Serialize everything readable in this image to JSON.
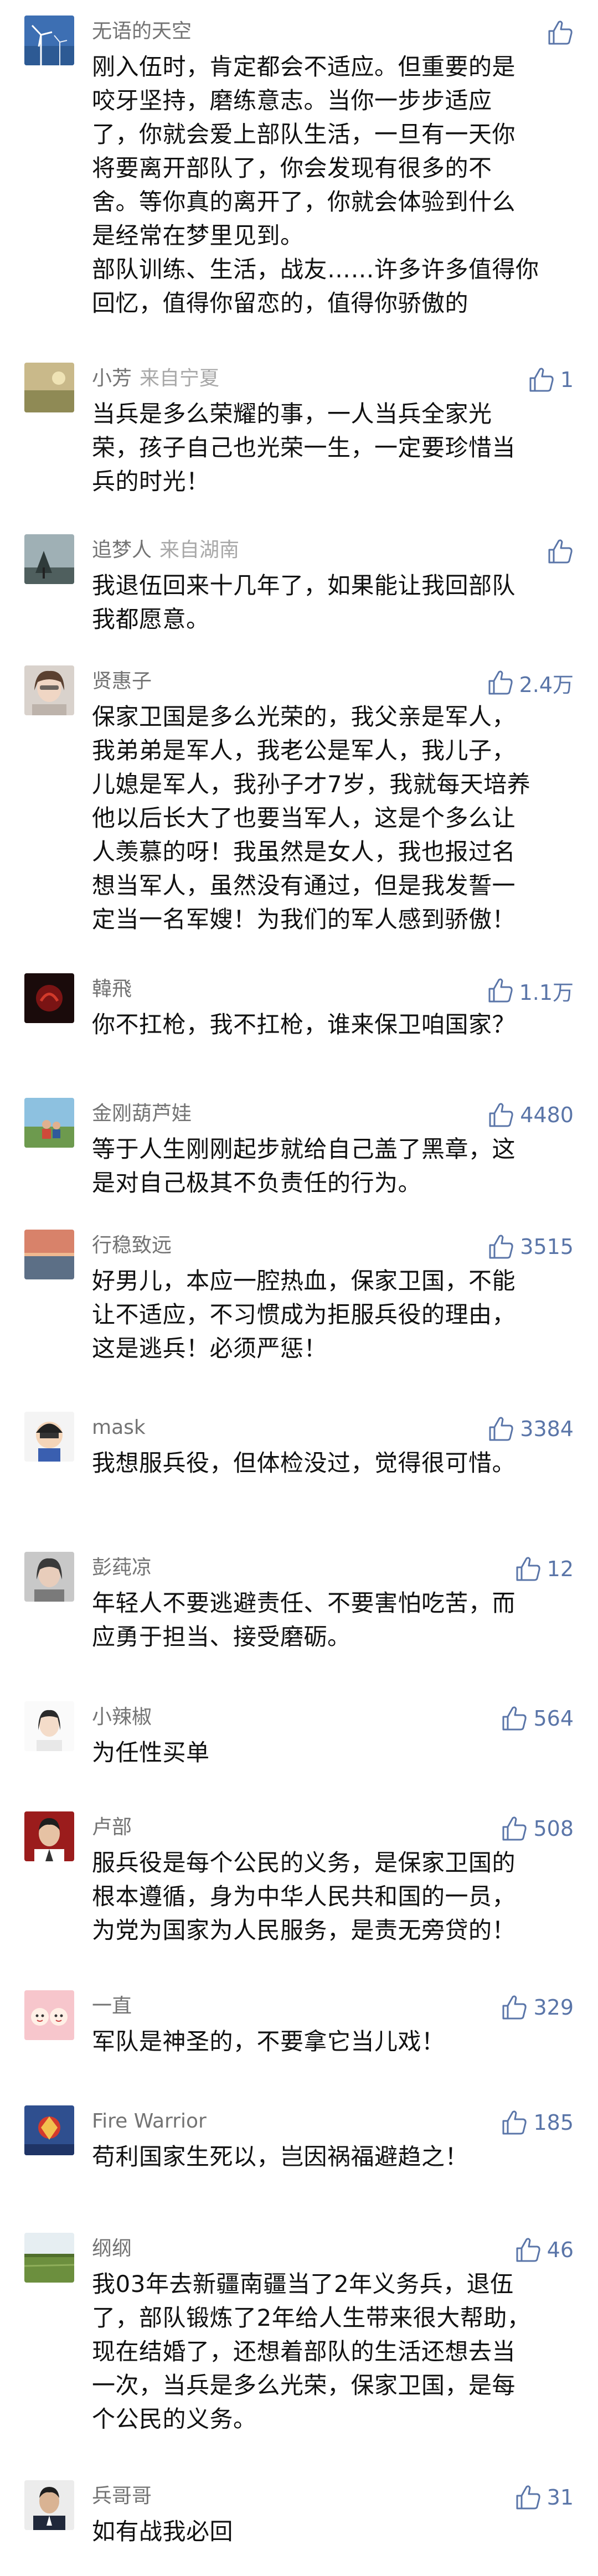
{
  "comments": [
    {
      "name": "无语的天空",
      "from": "",
      "likes": "",
      "avatar": "wind-turbine-avatar",
      "lines": [
        "刚入伍时，肯定都会不适应。但重要的是",
        "咬牙坚持，磨练意志。当你一步步适应",
        "了，你就会爱上部队生活，一旦有一天你",
        "将要离开部队了，你会发现有很多的不",
        "舍。等你真的离开了，你就会体验到什么",
        "是经常在梦里见到。",
        "部队训练、生活，战友……许多许多值得你",
        "回忆，值得你留恋的，值得你骄傲的"
      ]
    },
    {
      "name": "小芳",
      "from": "来自宁夏",
      "likes": "1",
      "avatar": "landscape-avatar",
      "lines": [
        "当兵是多么荣耀的事，一人当兵全家光",
        "荣，孩子自己也光荣一生，一定要珍惜当",
        "兵的时光！"
      ]
    },
    {
      "name": "追梦人",
      "from": "来自湖南",
      "likes": "",
      "avatar": "misty-tree-avatar",
      "lines": [
        "我退伍回来十几年了，如果能让我回部队",
        "我都愿意。"
      ]
    },
    {
      "name": "贤惠子",
      "from": "",
      "likes": "2.4万",
      "avatar": "woman-portrait-avatar",
      "lines": [
        "保家卫国是多么光荣的，我父亲是军人，",
        "我弟弟是军人，我老公是军人，我儿子，",
        "儿媳是军人，我孙子才7岁，我就每天培养",
        "他以后长大了也要当军人，这是个多么让",
        "人羡慕的呀！我虽然是女人，我也报过名",
        "想当军人，虽然没有通过，但是我发誓一",
        "定当一名军嫂！为我们的军人感到骄傲！"
      ]
    },
    {
      "name": "韓飛",
      "from": "",
      "likes": "1.1万",
      "avatar": "dark-red-avatar",
      "lines": [
        "你不扛枪，我不扛枪，谁来保卫咱国家？"
      ]
    },
    {
      "name": "金刚葫芦娃",
      "from": "",
      "likes": "4480",
      "avatar": "field-people-avatar",
      "lines": [
        "等于人生刚刚起步就给自己盖了黑章，这",
        "是对自己极其不负责任的行为。"
      ]
    },
    {
      "name": "行稳致远",
      "from": "",
      "likes": "3515",
      "avatar": "sunset-water-avatar",
      "lines": [
        "好男儿，本应一腔热血，保家卫国，不能",
        "让不适应，不习惯成为拒服兵役的理由，",
        "这是逃兵！必须严惩！"
      ]
    },
    {
      "name": "mask",
      "from": "",
      "likes": "3384",
      "avatar": "cartoon-mask-avatar",
      "lines": [
        "我想服兵役，但体检没过，觉得很可惜。"
      ]
    },
    {
      "name": "彭莼凉",
      "from": "",
      "likes": "12",
      "avatar": "woman-gray-avatar",
      "lines": [
        "年轻人不要逃避责任、不要害怕吃苦，而",
        "应勇于担当、接受磨砺。"
      ]
    },
    {
      "name": "小辣椒",
      "from": "",
      "likes": "564",
      "avatar": "girl-white-avatar",
      "lines": [
        "为任性买单"
      ]
    },
    {
      "name": "卢部",
      "from": "",
      "likes": "508",
      "avatar": "man-red-avatar",
      "lines": [
        "服兵役是每个公民的义务，是保家卫国的",
        "根本遵循，身为中华人民共和国的一员，",
        "为党为国家为人民服务，是责无旁贷的！"
      ]
    },
    {
      "name": "一直",
      "from": "",
      "likes": "329",
      "avatar": "pink-cartoon-avatar",
      "lines": [
        "军队是神圣的，不要拿它当儿戏！"
      ]
    },
    {
      "name": "Fire Warrior",
      "from": "",
      "likes": "185",
      "avatar": "blue-red-avatar",
      "lines": [
        "苟利国家生死以，岂因祸福避趋之！"
      ]
    },
    {
      "name": "纲纲",
      "from": "",
      "likes": "46",
      "avatar": "field-sky-avatar",
      "lines": [
        "我03年去新疆南疆当了2年义务兵，退伍",
        "了，部队锻炼了2年给人生带来很大帮助，",
        "现在结婚了，还想着部队的生活还想去当",
        "一次，当兵是多么光荣，保家卫国，是每",
        "个公民的义务。"
      ]
    },
    {
      "name": "兵哥哥",
      "from": "",
      "likes": "31",
      "avatar": "man-portrait-avatar",
      "lines": [
        "如有战我必回"
      ]
    }
  ]
}
